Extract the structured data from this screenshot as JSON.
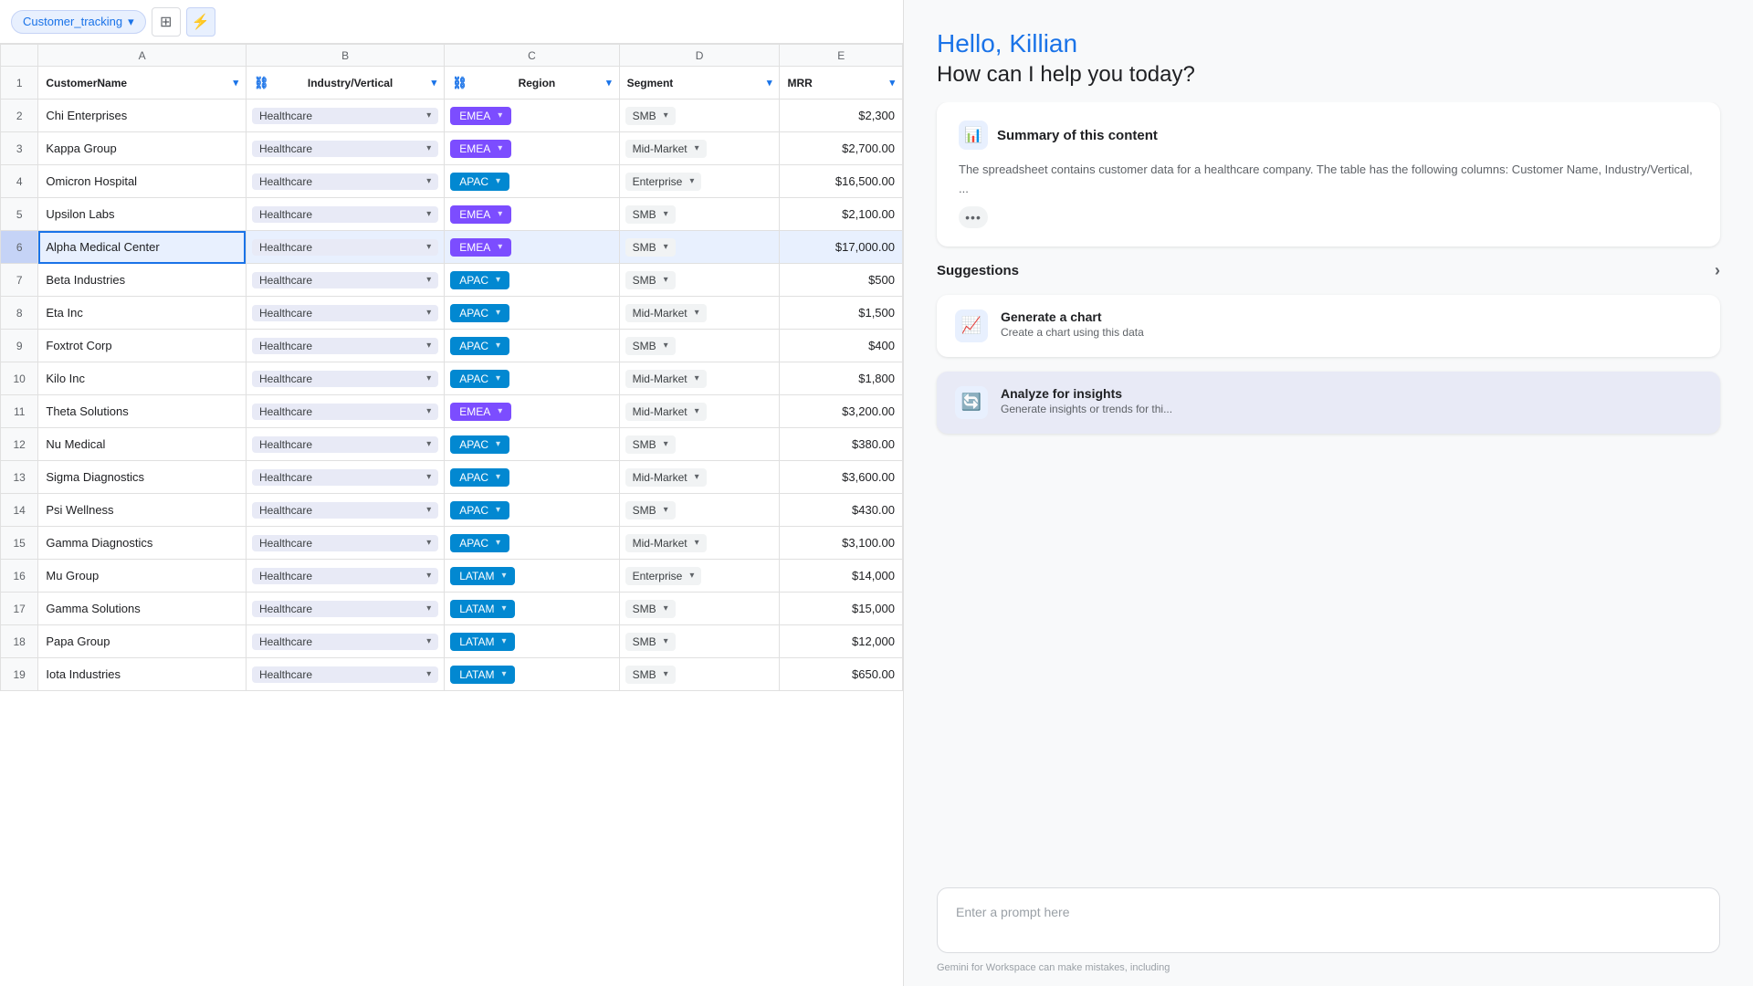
{
  "sheet": {
    "toolbar": {
      "sheet_name": "Customer_tracking",
      "dropdown_icon": "▾",
      "table_icon": "⊞",
      "lightning_icon": "⚡"
    },
    "columns": {
      "letters": [
        "",
        "A",
        "B",
        "C",
        "D",
        "E"
      ],
      "headers": [
        {
          "label": "CustomerName",
          "filter": true
        },
        {
          "label": "Industry/Vertical",
          "filter": true
        },
        {
          "label": "Region",
          "filter": true
        },
        {
          "label": "Segment",
          "filter": true
        },
        {
          "label": "MRR",
          "filter": true
        }
      ]
    },
    "rows": [
      {
        "num": 2,
        "name": "Chi Enterprises",
        "industry": "Healthcare",
        "region": "EMEA",
        "region_class": "emea",
        "segment": "SMB",
        "seg_class": "",
        "mrr": "$2,300"
      },
      {
        "num": 3,
        "name": "Kappa Group",
        "industry": "Healthcare",
        "region": "EMEA",
        "region_class": "emea",
        "segment": "Mid-Market",
        "seg_class": "",
        "mrr": "$2,700.00"
      },
      {
        "num": 4,
        "name": "Omicron Hospital",
        "industry": "Healthcare",
        "region": "APAC",
        "region_class": "apac",
        "segment": "Enterprise",
        "seg_class": "",
        "mrr": "$16,500.00"
      },
      {
        "num": 5,
        "name": "Upsilon Labs",
        "industry": "Healthcare",
        "region": "EMEA",
        "region_class": "emea",
        "segment": "SMB",
        "seg_class": "",
        "mrr": "$2,100.00"
      },
      {
        "num": 6,
        "name": "Alpha Medical Center",
        "industry": "Healthcare",
        "region": "EMEA",
        "region_class": "emea",
        "segment": "SMB",
        "seg_class": "",
        "mrr": "$17,000.00",
        "selected": true
      },
      {
        "num": 7,
        "name": "Beta Industries",
        "industry": "Healthcare",
        "region": "APAC",
        "region_class": "apac",
        "segment": "SMB",
        "seg_class": "",
        "mrr": "$500"
      },
      {
        "num": 8,
        "name": "Eta Inc",
        "industry": "Healthcare",
        "region": "APAC",
        "region_class": "apac",
        "segment": "Mid-Market",
        "seg_class": "",
        "mrr": "$1,500"
      },
      {
        "num": 9,
        "name": "Foxtrot Corp",
        "industry": "Healthcare",
        "region": "APAC",
        "region_class": "apac",
        "segment": "SMB",
        "seg_class": "",
        "mrr": "$400"
      },
      {
        "num": 10,
        "name": "Kilo Inc",
        "industry": "Healthcare",
        "region": "APAC",
        "region_class": "apac",
        "segment": "Mid-Market",
        "seg_class": "",
        "mrr": "$1,800"
      },
      {
        "num": 11,
        "name": "Theta Solutions",
        "industry": "Healthcare",
        "region": "EMEA",
        "region_class": "emea",
        "segment": "Mid-Market",
        "seg_class": "",
        "mrr": "$3,200.00"
      },
      {
        "num": 12,
        "name": "Nu Medical",
        "industry": "Healthcare",
        "region": "APAC",
        "region_class": "apac",
        "segment": "SMB",
        "seg_class": "",
        "mrr": "$380.00"
      },
      {
        "num": 13,
        "name": "Sigma Diagnostics",
        "industry": "Healthcare",
        "region": "APAC",
        "region_class": "apac",
        "segment": "Mid-Market",
        "seg_class": "",
        "mrr": "$3,600.00"
      },
      {
        "num": 14,
        "name": "Psi Wellness",
        "industry": "Healthcare",
        "region": "APAC",
        "region_class": "apac",
        "segment": "SMB",
        "seg_class": "",
        "mrr": "$430.00"
      },
      {
        "num": 15,
        "name": "Gamma Diagnostics",
        "industry": "Healthcare",
        "region": "APAC",
        "region_class": "apac",
        "segment": "Mid-Market",
        "seg_class": "",
        "mrr": "$3,100.00"
      },
      {
        "num": 16,
        "name": "Mu Group",
        "industry": "Healthcare",
        "region": "LATAM",
        "region_class": "latam",
        "segment": "Enterprise",
        "seg_class": "",
        "mrr": "$14,000"
      },
      {
        "num": 17,
        "name": "Gamma Solutions",
        "industry": "Healthcare",
        "region": "LATAM",
        "region_class": "latam",
        "segment": "SMB",
        "seg_class": "",
        "mrr": "$15,000"
      },
      {
        "num": 18,
        "name": "Papa Group",
        "industry": "Healthcare",
        "region": "LATAM",
        "region_class": "latam",
        "segment": "SMB",
        "seg_class": "",
        "mrr": "$12,000"
      },
      {
        "num": 19,
        "name": "Iota Industries",
        "industry": "Healthcare",
        "region": "LATAM",
        "region_class": "latam",
        "segment": "SMB",
        "seg_class": "",
        "mrr": "$650.00"
      }
    ]
  },
  "gemini": {
    "greeting": "Hello, Killian",
    "subtitle": "How can I help you today?",
    "summary": {
      "icon": "📊",
      "title": "Summary of this content",
      "text": "The spreadsheet contains customer data for a healthcare company. The table has the following columns: Customer Name, Industry/Vertical, ...",
      "ellipsis": "•••"
    },
    "suggestions_label": "Suggestions",
    "suggestions": [
      {
        "icon": "📈",
        "title": "Generate a chart",
        "desc": "Create a chart using this data"
      },
      {
        "icon": "🔄",
        "title": "Analyze for insights",
        "desc": "Generate insights or trends for thi..."
      }
    ],
    "prompt_placeholder": "Enter a prompt here",
    "disclaimer": "Gemini for Workspace can make mistakes, including"
  }
}
